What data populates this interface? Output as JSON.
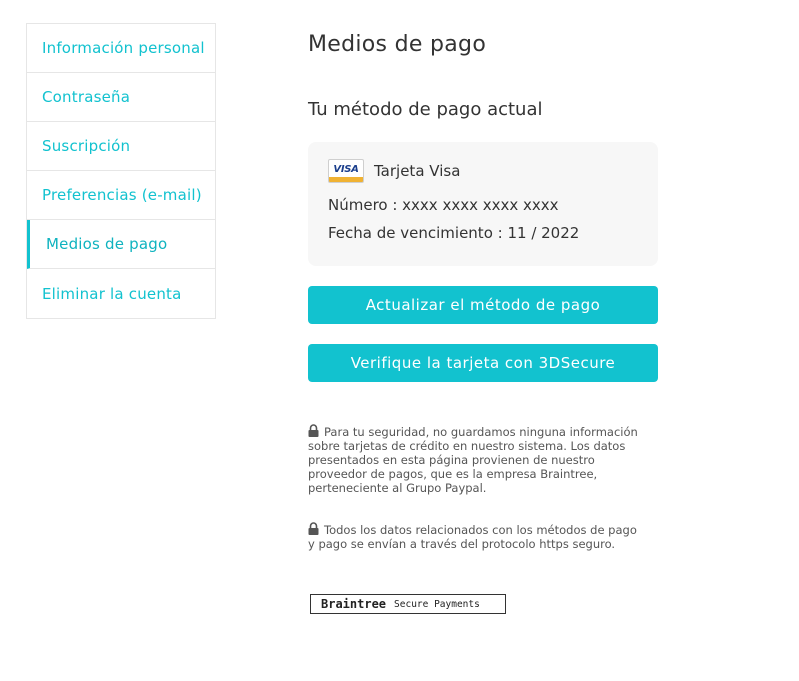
{
  "sidebar": {
    "items": [
      {
        "label": "Información personal",
        "active": false
      },
      {
        "label": "Contraseña",
        "active": false
      },
      {
        "label": "Suscripción",
        "active": false
      },
      {
        "label": "Preferencias (e-mail)",
        "active": false
      },
      {
        "label": "Medios de pago",
        "active": true
      },
      {
        "label": "Eliminar la cuenta",
        "active": false
      }
    ]
  },
  "main": {
    "title": "Medios de pago",
    "section_title": "Tu método de pago actual",
    "card": {
      "logo_text": "VISA",
      "type": "Tarjeta Visa",
      "number_line": "Número : xxxx xxxx xxxx xxxx",
      "expiry_line": "Fecha de vencimiento : 11 / 2022"
    },
    "buttons": {
      "update": "Actualizar el método de pago",
      "verify": "Verifique la tarjeta con 3DSecure"
    },
    "notes": {
      "security": "Para tu seguridad, no guardamos ninguna información sobre tarjetas de crédito en nuestro sistema. Los datos presentados en esta página provienen de nuestro proveedor de pagos, que es la empresa Braintree, perteneciente al Grupo Paypal.",
      "https": "Todos los datos relacionados con los métodos de pago y pago se envían a través del protocolo https seguro."
    },
    "badge": {
      "name": "Braintree",
      "subtitle": "Secure Payments"
    }
  },
  "colors": {
    "accent": "#12c2cf",
    "card_bg": "#f7f7f7",
    "border": "#e6e6e6"
  },
  "icons": {
    "lock": "lock-icon",
    "card_brand": "visa-logo"
  }
}
